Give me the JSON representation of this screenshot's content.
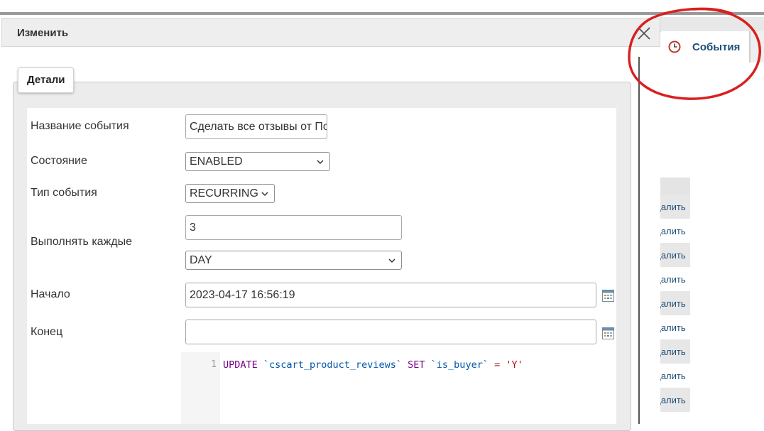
{
  "dialog": {
    "title": "Изменить",
    "tab": "Детали",
    "fields": {
      "event_name_label": "Название события",
      "event_name_value": "Сделать все отзывы от Пок",
      "state_label": "Состояние",
      "state_value": "ENABLED",
      "type_label": "Тип события",
      "type_value": "RECURRING",
      "interval_label": "Выполнять каждые",
      "interval_value": "3",
      "interval_unit": "DAY",
      "start_label": "Начало",
      "start_value": "2023-04-17 16:56:19",
      "end_label": "Конец",
      "end_value": ""
    },
    "code": {
      "line_number": "1",
      "kw_update": "UPDATE",
      "table": "`cscart_product_reviews`",
      "kw_set": "SET",
      "column": "`is_buyer`",
      "op": "=",
      "value": "'Y'"
    }
  },
  "background": {
    "tab_label": "События",
    "row_action_label": "Удалить",
    "accent_color": "#1e4d78",
    "annotation_color": "#d9201f"
  }
}
